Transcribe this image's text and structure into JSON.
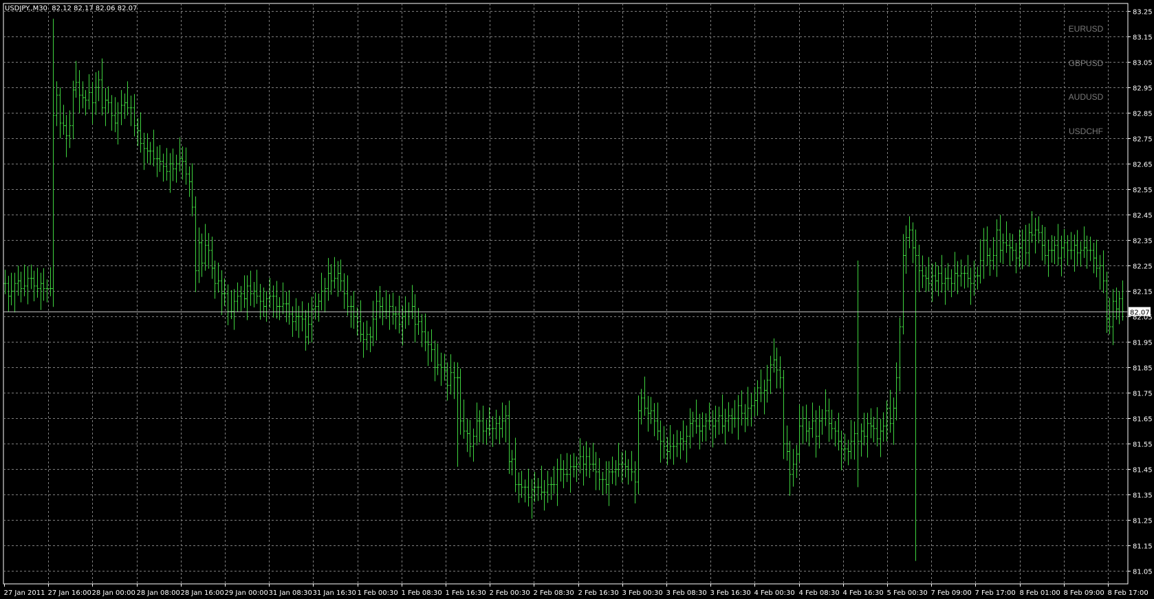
{
  "header": {
    "symbol": "USDJPY.,M30",
    "ohlc": "82.12 82.17 82.06 82.07"
  },
  "symbol_list": [
    "EURUSD",
    "GBPUSD",
    "AUDUSD",
    "USDCHF"
  ],
  "colors": {
    "background": "#000000",
    "bars": "#3fd43f",
    "grid": "#7f7f7f",
    "axis": "#ffffff",
    "symbols": "#7a7a7a"
  },
  "chart_data": {
    "type": "bar",
    "style": "ohlc-bars",
    "symbol": "USDJPY.",
    "timeframe": "M30",
    "last_price": 82.07,
    "ylim": [
      81.0,
      83.27
    ],
    "y_ticks": [
      "83.25",
      "83.15",
      "83.05",
      "82.95",
      "82.85",
      "82.75",
      "82.65",
      "82.55",
      "82.45",
      "82.35",
      "82.25",
      "82.15",
      "82.05",
      "81.95",
      "81.85",
      "81.75",
      "81.65",
      "81.55",
      "81.45",
      "81.35",
      "81.25",
      "81.15",
      "81.05"
    ],
    "x_ticks": [
      "27 Jan 2011",
      "27 Jan 16:00",
      "28 Jan 00:00",
      "28 Jan 08:00",
      "28 Jan 16:00",
      "29 Jan 00:00",
      "31 Jan 08:30",
      "31 Jan 16:30",
      "1 Feb 00:30",
      "1 Feb 08:30",
      "1 Feb 16:30",
      "2 Feb 00:30",
      "2 Feb 08:30",
      "2 Feb 16:30",
      "3 Feb 00:30",
      "3 Feb 08:30",
      "3 Feb 16:30",
      "4 Feb 00:30",
      "4 Feb 08:30",
      "4 Feb 16:30",
      "5 Feb 00:30",
      "7 Feb 09:00",
      "7 Feb 17:00",
      "8 Feb 01:00",
      "8 Feb 09:00",
      "8 Feb 17:00"
    ],
    "grid": true,
    "closes": [
      82.18,
      82.13,
      82.15,
      82.18,
      82.19,
      82.16,
      82.17,
      82.2,
      82.2,
      82.17,
      82.16,
      82.18,
      82.16,
      82.16,
      82.16,
      82.84,
      82.92,
      82.81,
      82.8,
      82.76,
      82.8,
      82.94,
      82.97,
      82.92,
      82.91,
      82.9,
      82.93,
      82.89,
      82.95,
      82.98,
      82.87,
      82.9,
      82.89,
      82.84,
      82.81,
      82.85,
      82.88,
      82.89,
      82.87,
      82.87,
      82.8,
      82.78,
      82.73,
      82.71,
      82.7,
      82.7,
      82.67,
      82.67,
      82.66,
      82.64,
      82.62,
      82.65,
      82.63,
      82.65,
      82.67,
      82.66,
      82.61,
      82.58,
      82.48,
      82.23,
      82.34,
      82.26,
      82.33,
      82.31,
      82.24,
      82.18,
      82.19,
      82.14,
      82.14,
      82.07,
      82.07,
      82.11,
      82.13,
      82.14,
      82.12,
      82.17,
      82.14,
      82.15,
      82.13,
      82.11,
      82.09,
      82.12,
      82.13,
      82.13,
      82.09,
      82.09,
      82.1,
      82.1,
      82.06,
      82.03,
      82.05,
      82.05,
      82.04,
      81.97,
      82.02,
      82.08,
      82.09,
      82.11,
      82.15,
      82.16,
      82.22,
      82.19,
      82.2,
      82.22,
      82.19,
      82.14,
      82.09,
      82.09,
      82.05,
      82.03,
      81.98,
      81.96,
      81.98,
      81.97,
      82.04,
      82.11,
      82.09,
      82.07,
      82.07,
      82.09,
      82.06,
      82.06,
      82.02,
      82.05,
      82.07,
      82.07,
      82.09,
      82.02,
      82.03,
      81.99,
      81.95,
      81.94,
      81.92,
      81.85,
      81.86,
      81.85,
      81.84,
      81.78,
      81.83,
      81.81,
      81.81,
      81.64,
      81.6,
      81.59,
      81.54,
      81.58,
      81.64,
      81.64,
      81.6,
      81.61,
      81.61,
      81.61,
      81.63,
      81.61,
      81.64,
      81.66,
      81.48,
      81.49,
      81.39,
      81.39,
      81.38,
      81.38,
      81.34,
      81.37,
      81.38,
      81.38,
      81.36,
      81.36,
      81.39,
      81.39,
      81.39,
      81.45,
      81.45,
      81.43,
      81.43,
      81.46,
      81.46,
      81.47,
      81.5,
      81.47,
      81.5,
      81.47,
      81.47,
      81.44,
      81.41,
      81.41,
      81.39,
      81.44,
      81.44,
      81.45,
      81.47,
      81.47,
      81.46,
      81.45,
      81.44,
      81.4,
      81.68,
      81.73,
      81.69,
      81.67,
      81.68,
      81.64,
      81.6,
      81.56,
      81.54,
      81.52,
      81.54,
      81.54,
      81.55,
      81.57,
      81.56,
      81.58,
      81.63,
      81.64,
      81.62,
      81.6,
      81.62,
      81.64,
      81.64,
      81.62,
      81.64,
      81.66,
      81.62,
      81.64,
      81.66,
      81.65,
      81.65,
      81.7,
      81.67,
      81.65,
      81.69,
      81.7,
      81.72,
      81.77,
      81.75,
      81.76,
      81.8,
      81.86,
      81.88,
      81.84,
      81.81,
      81.55,
      81.52,
      81.43,
      81.47,
      81.51,
      81.62,
      81.65,
      81.6,
      81.61,
      81.64,
      81.58,
      81.64,
      81.65,
      81.68,
      81.63,
      81.61,
      81.6,
      81.56,
      81.53,
      81.53,
      81.52,
      81.56,
      81.59,
      81.56,
      81.6,
      81.58,
      81.63,
      81.62,
      81.61,
      81.57,
      81.6,
      81.62,
      81.69,
      81.63,
      81.69,
      81.81,
      82.01,
      82.29,
      82.36,
      82.39,
      82.32,
      82.29,
      82.23,
      82.21,
      82.2,
      82.18,
      82.21,
      82.19,
      82.22,
      82.18,
      82.2,
      82.2,
      82.18,
      82.22,
      82.21,
      82.22,
      82.22,
      82.2,
      82.18,
      82.21,
      82.21,
      82.27,
      82.35,
      82.29,
      82.27,
      82.29,
      82.39,
      82.31,
      82.34,
      82.33,
      82.32,
      82.31,
      82.28,
      82.32,
      82.35,
      82.3,
      82.38,
      82.37,
      82.39,
      82.38,
      82.33,
      82.29,
      82.31,
      82.31,
      82.33,
      82.28,
      82.32,
      82.34,
      82.31,
      82.31,
      82.33,
      82.3,
      82.31,
      82.32,
      82.31,
      82.31,
      82.28,
      82.24,
      82.25,
      82.19,
      82.04,
      82.01,
      82.11,
      82.08,
      82.12,
      82.07
    ]
  }
}
